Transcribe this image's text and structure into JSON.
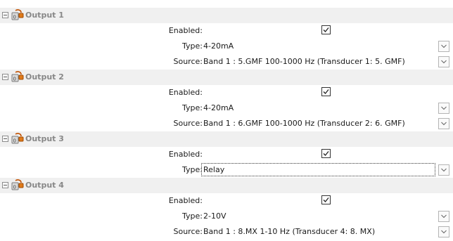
{
  "outputs": [
    {
      "title": "Output 1",
      "enabled_label": "Enabled:",
      "enabled": true,
      "type_label": "Type:",
      "type_value": "4-20mA",
      "source_label": "Source:",
      "source_value": "Band 1 : 5.GMF 100-1000 Hz (Transducer 1: 5. GMF)"
    },
    {
      "title": "Output 2",
      "enabled_label": "Enabled:",
      "enabled": true,
      "type_label": "Type:",
      "type_value": "4-20mA",
      "source_label": "Source:",
      "source_value": "Band 1 : 6.GMF 100-1000 Hz (Transducer 2: 6. GMF)"
    },
    {
      "title": "Output 3",
      "enabled_label": "Enabled:",
      "enabled": true,
      "type_label": "Type:",
      "type_value": "Relay"
    },
    {
      "title": "Output 4",
      "enabled_label": "Enabled:",
      "enabled": true,
      "type_label": "Type:",
      "type_value": "2-10V",
      "source_label": "Source:",
      "source_value": "Band 1 : 8.MX 1-10 Hz (Transducer 4: 8. MX)"
    }
  ],
  "icons": {
    "collapse": "collapse-minus-icon",
    "output": "output-plug-icon",
    "check": "checkmark-icon",
    "dropdown": "chevron-down-icon"
  },
  "colors": {
    "group_bg": "#f0f0f0",
    "group_title": "#888888"
  }
}
